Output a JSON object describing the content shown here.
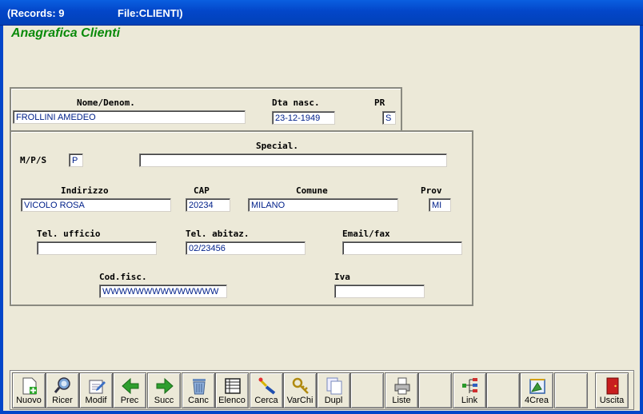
{
  "window": {
    "records": "(Records: 9",
    "file": "File:CLIENTI)"
  },
  "form": {
    "title": "Anagrafica Clienti",
    "nome_label": "Nome/Denom.",
    "nome_value": "FROLLINI AMEDEO",
    "dta_label": "Dta nasc.",
    "dta_value": "23-12-1949",
    "pr_label": "PR",
    "pr_value": "S",
    "mps_label": "M/P/S",
    "mps_value": "P",
    "special_label": "Special.",
    "special_value": "",
    "indirizzo_label": "Indirizzo",
    "indirizzo_value": "VICOLO ROSA",
    "cap_label": "CAP",
    "cap_value": "20234",
    "comune_label": "Comune",
    "comune_value": "MILANO",
    "prov_label": "Prov",
    "prov_value": "MI",
    "tel_uff_label": "Tel. ufficio",
    "tel_uff_value": "",
    "tel_abit_label": "Tel. abitaz.",
    "tel_abit_value": "02/23456",
    "email_label": "Email/fax",
    "email_value": "",
    "codfisc_label": "Cod.fisc.",
    "codfisc_value": "WWWWWWWWWWWWWW",
    "iva_label": "Iva",
    "iva_value": ""
  },
  "toolbar": {
    "nuovo": "Nuovo",
    "ricer": "Ricer",
    "modif": "Modif",
    "prec": "Prec",
    "succ": "Succ",
    "canc": "Canc",
    "elenco": "Elenco",
    "cerca": "Cerca",
    "varchi": "VarChi",
    "dupl": "Dupl",
    "liste": "Liste",
    "link": "Link",
    "crea": "4Crea",
    "uscita": "Uscita"
  },
  "colors": {
    "titlebar": "#0346c9",
    "heading": "#0a8a0a",
    "field_text": "#00208a",
    "background": "#ece9d8"
  },
  "icons": [
    "new-document-icon",
    "search-binoculars-icon",
    "edit-icon",
    "arrow-left-icon",
    "arrow-right-icon",
    "trash-icon",
    "list-icon",
    "find-icon",
    "keys-icon",
    "duplicate-icon",
    "printer-icon",
    "link-tree-icon",
    "create-icon",
    "exit-door-icon"
  ]
}
